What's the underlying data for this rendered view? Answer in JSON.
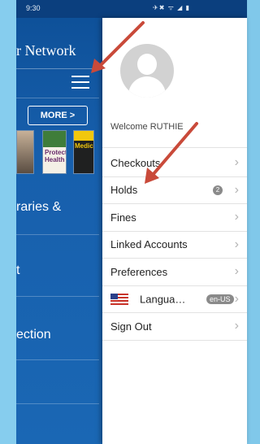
{
  "status": {
    "time": "9:30",
    "icons": "✈✖ ᯤ ◢ ▮"
  },
  "background_app": {
    "title": "r Network",
    "more_button": "MORE >",
    "book2_text": "Protecting Health",
    "book3_text": "Medican",
    "items": [
      "raries &",
      "t",
      "ection"
    ]
  },
  "drawer": {
    "welcome": "Welcome RUTHIE",
    "menu": [
      {
        "label": "Checkouts"
      },
      {
        "label": "Holds",
        "count": "2"
      },
      {
        "label": "Fines"
      },
      {
        "label": "Linked Accounts"
      },
      {
        "label": "Preferences"
      },
      {
        "label": "Langua…",
        "badge": "en-US"
      },
      {
        "label": "Sign Out"
      }
    ]
  },
  "colors": {
    "app_blue": "#175fac",
    "frame_blue": "#86cdee",
    "drawer_bg": "#ffffff",
    "arrow_red": "#c94a3a"
  },
  "icons": {
    "hamburger": "menu-icon",
    "avatar": "user-avatar-icon",
    "chevron": "chevron-right-icon",
    "flag": "us-flag-icon"
  }
}
